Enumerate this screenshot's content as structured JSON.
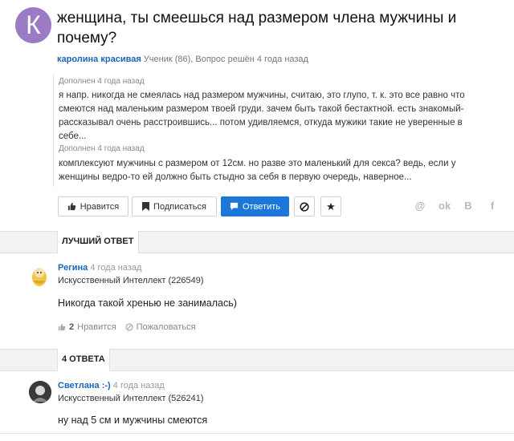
{
  "question": {
    "avatar_letter": "К",
    "avatar_color": "#9b7bc4",
    "title": "женщина, ты смеешься над размером члена мужчины и почему?",
    "author": "каролина красивая",
    "meta": "Ученик (86), Вопрос решён 4 года назад",
    "addenda": [
      {
        "label": "Дополнен 4 года назад",
        "lines": [
          "я напр. никогда не смеялась над размером мужчины, считаю, это глупо, т. к. это все равно что",
          "смеются над маленьким размером твоей груди. зачем быть такой бестактной. есть знакомый-",
          "рассказывал очень расстроившись... потом удивляемся, откуда мужики такие не уверенные в",
          "себе..."
        ]
      },
      {
        "label": "Дополнен 4 года назад",
        "lines": [
          "комплексуют мужчины с размером от 12см. но разве это маленький для секса? ведь, если у",
          "женщины ведро-то ей должно быть стыдно за себя в первую очередь, наверное..."
        ]
      }
    ]
  },
  "toolbar": {
    "like_label": "Нравится",
    "subscribe_label": "Подписаться",
    "reply_label": "Ответить",
    "share": [
      "@",
      "ok",
      "В",
      "f"
    ]
  },
  "best": {
    "section_title": "ЛУЧШИЙ ОТВЕТ",
    "name": "Регина",
    "time": "4 года назад",
    "rank": "Искусственный Интеллект (226549)",
    "text": "Никогда такой хренью не занималась)",
    "likes": "2",
    "likes_label": "Нравится",
    "report_label": "Пожаловаться"
  },
  "answers": {
    "section_title": "4 ОТВЕТА",
    "items": [
      {
        "name": "Светлана :-)",
        "time": "4 года назад",
        "rank": "Искусственный Интеллект (526241)",
        "text": "ну над 5 см и мужчины смеются"
      }
    ]
  }
}
